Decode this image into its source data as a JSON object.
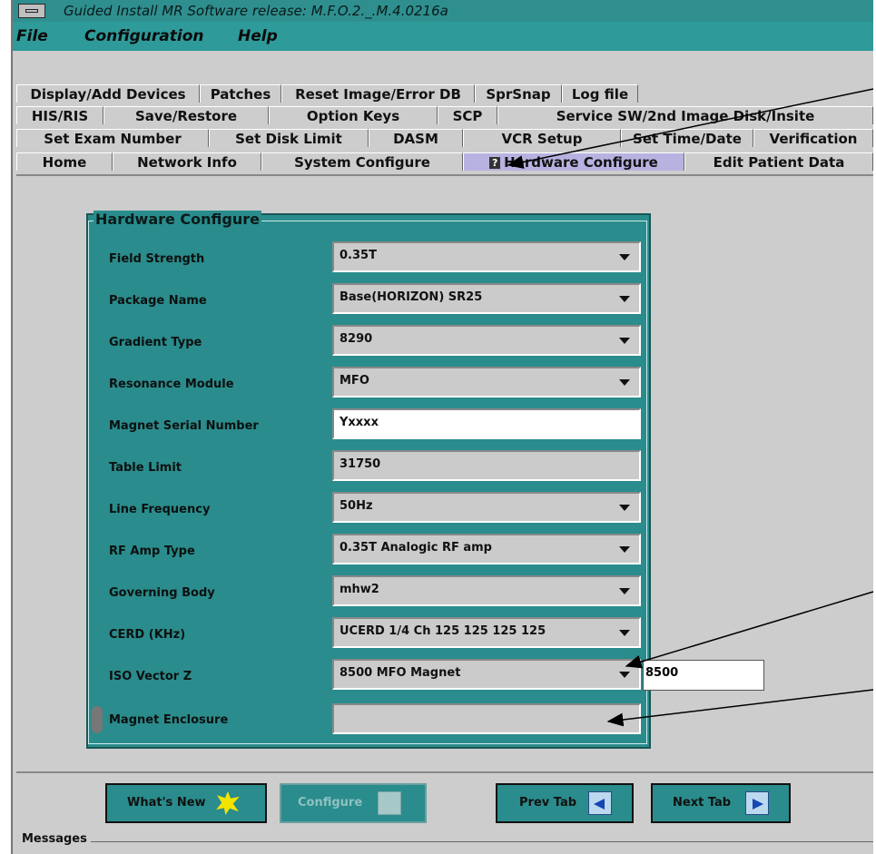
{
  "window": {
    "title": "Guided Install  MR Software release: M.F.O.2._.M.4.0216a"
  },
  "menubar": {
    "items": [
      "File",
      "Configuration",
      "Help"
    ]
  },
  "tabs": {
    "row1": [
      "Display/Add Devices",
      "Patches",
      "Reset Image/Error DB",
      "SprSnap",
      "Log file"
    ],
    "row2": [
      "HIS/RIS",
      "Save/Restore",
      "Option Keys",
      "SCP",
      "Service SW/2nd Image Disk/Insite"
    ],
    "row3": [
      "Set Exam Number",
      "Set Disk Limit",
      "DASM",
      "VCR Setup",
      "Set Time/Date",
      "Verification"
    ],
    "row4": [
      "Home",
      "Network Info",
      "System Configure",
      "Hardware Configure",
      "Edit Patient Data"
    ],
    "active": "Hardware Configure",
    "active_icon": "?"
  },
  "panel": {
    "title": "Hardware Configure",
    "fields": [
      {
        "label": "Field Strength",
        "value": "0.35T"
      },
      {
        "label": "Package Name",
        "value": "Base(HORIZON) SR25"
      },
      {
        "label": "Gradient Type",
        "value": "8290"
      },
      {
        "label": "Resonance Module",
        "value": "MFO"
      },
      {
        "label": "Magnet Serial Number",
        "value": "Yxxxx"
      },
      {
        "label": "Table Limit",
        "value": "31750"
      },
      {
        "label": "Line Frequency",
        "value": "50Hz"
      },
      {
        "label": "RF Amp Type",
        "value": "0.35T Analogic RF amp"
      },
      {
        "label": "Governing Body",
        "value": "mhw2"
      },
      {
        "label": "CERD (KHz)",
        "value": "UCERD 1/4 Ch 125  125  125  125"
      },
      {
        "label": "ISO Vector Z",
        "value": "8500 MFO Magnet",
        "extra_value": "8500"
      },
      {
        "label": "Magnet Enclosure",
        "value": ""
      }
    ]
  },
  "buttons": {
    "whats_new": "What's New",
    "configure": "Configure",
    "prev_tab": "Prev Tab",
    "next_tab": "Next Tab"
  },
  "messages": {
    "label": "Messages"
  },
  "colors": {
    "teal": "#2a8c8c",
    "active_tab": "#b7b2e0",
    "arrow_blue": "#1546b2"
  }
}
